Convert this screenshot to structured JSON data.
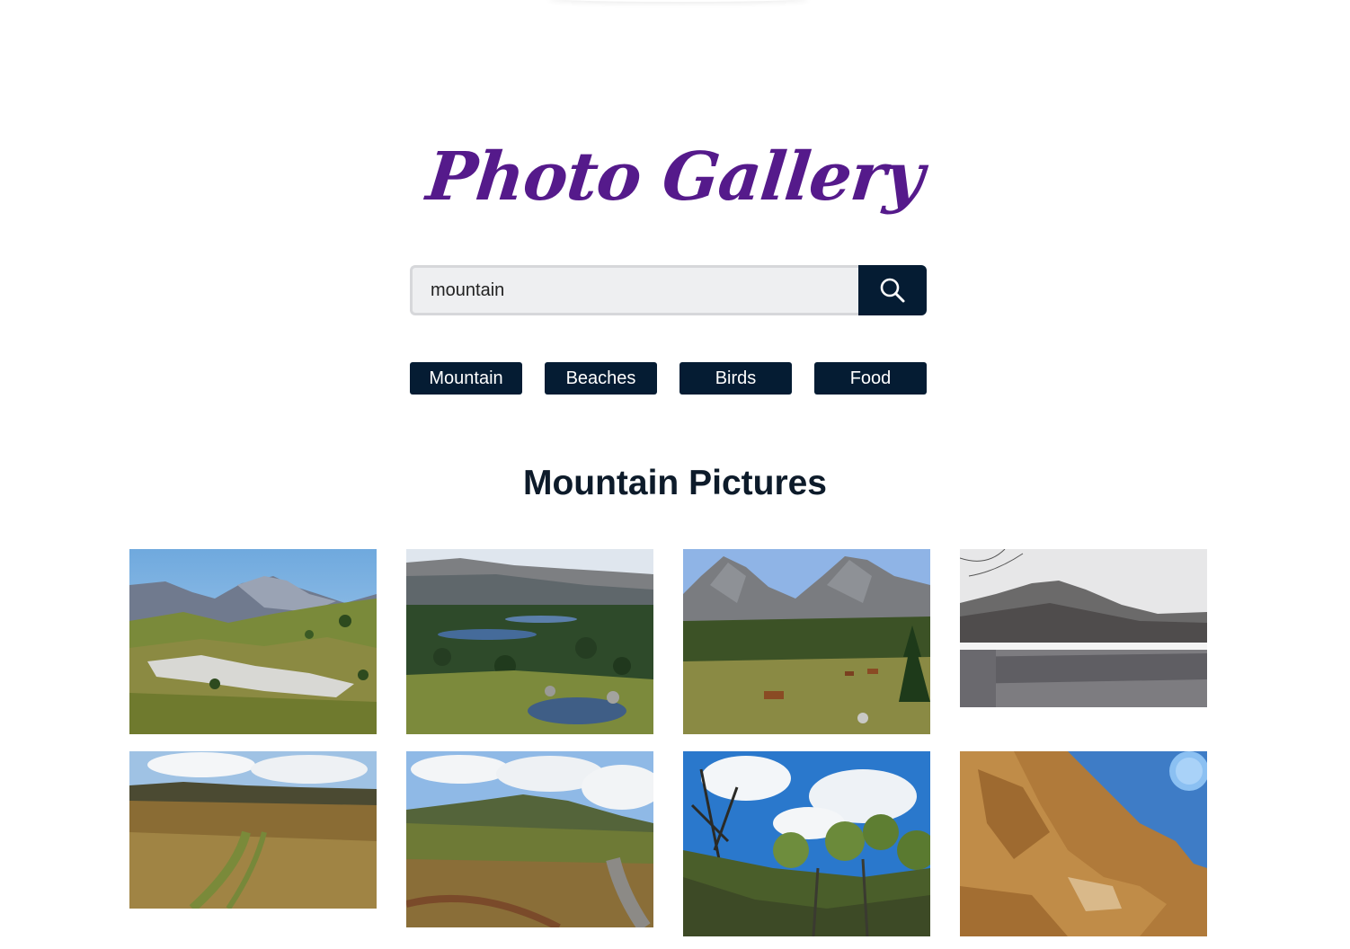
{
  "header": {
    "title": "Photo Gallery"
  },
  "search": {
    "value": "mountain",
    "button_icon": "search-icon"
  },
  "categories": [
    {
      "label": "Mountain"
    },
    {
      "label": "Beaches"
    },
    {
      "label": "Birds"
    },
    {
      "label": "Food"
    }
  ],
  "results": {
    "heading": "Mountain Pictures"
  },
  "colors": {
    "title": "#551a8b",
    "dark_navy": "#051c33",
    "heading_text": "#0d1b2a"
  }
}
